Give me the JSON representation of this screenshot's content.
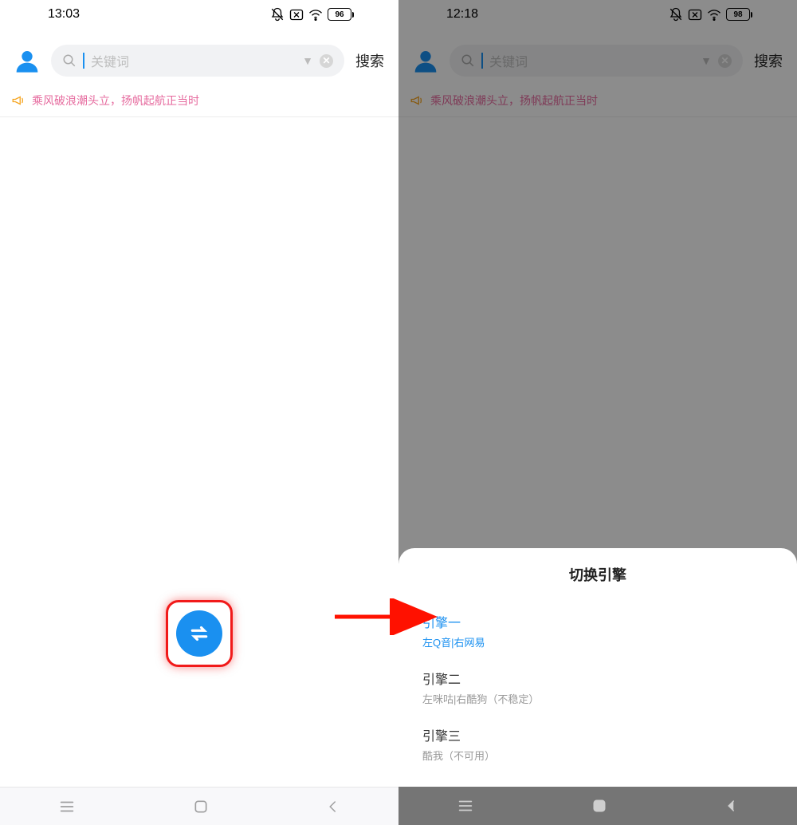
{
  "left": {
    "status": {
      "time": "13:03",
      "battery": "96"
    },
    "search": {
      "placeholder": "关键词",
      "button": "搜索"
    },
    "announce": "乘风破浪潮头立，扬帆起航正当时"
  },
  "right": {
    "status": {
      "time": "12:18",
      "battery": "98"
    },
    "search": {
      "placeholder": "关键词",
      "button": "搜索"
    },
    "announce": "乘风破浪潮头立，扬帆起航正当时",
    "sheet": {
      "title": "切换引擎",
      "engines": [
        {
          "name": "引擎一",
          "desc": "左Q音|右网易"
        },
        {
          "name": "引擎二",
          "desc": "左咪咕|右酷狗（不稳定）"
        },
        {
          "name": "引擎三",
          "desc": "酷我（不可用）"
        }
      ]
    }
  }
}
